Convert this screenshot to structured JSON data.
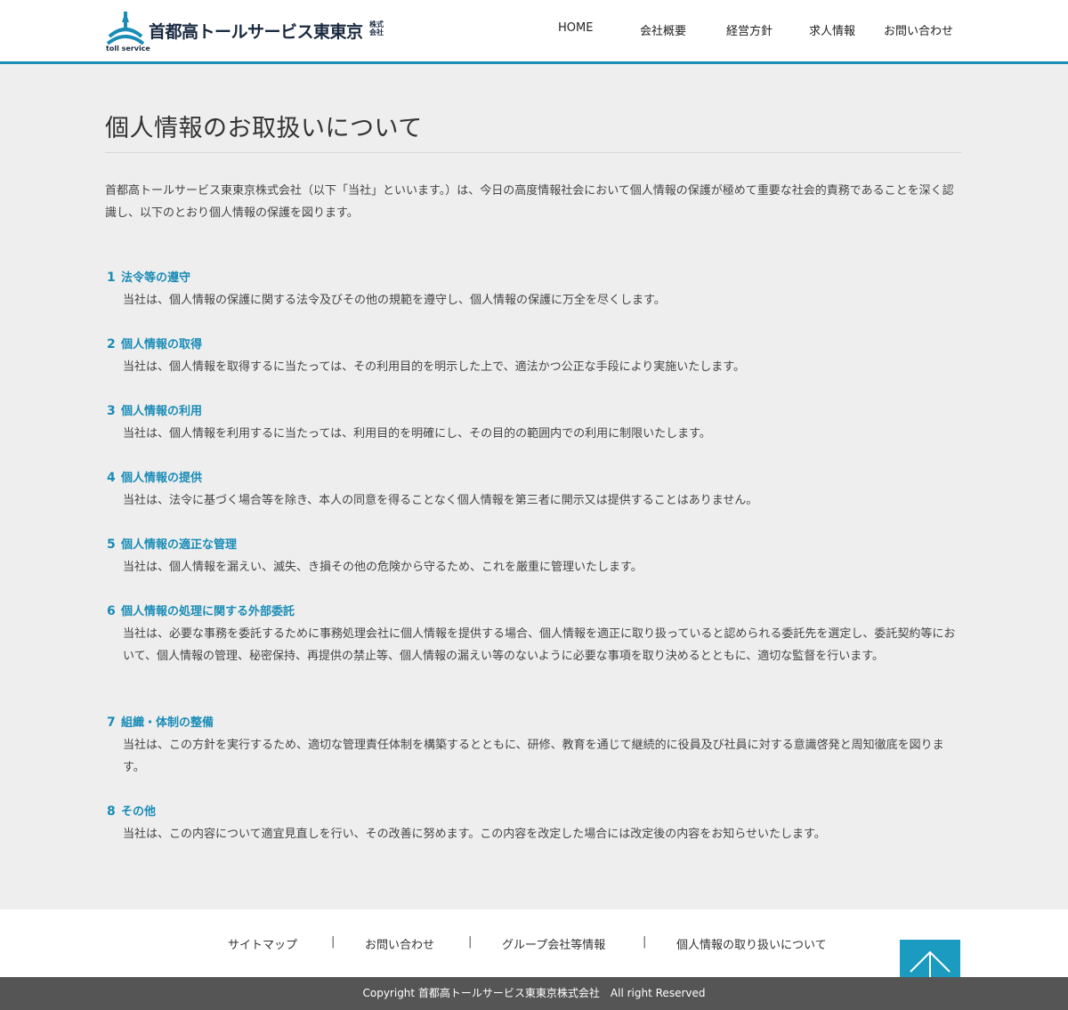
{
  "header": {
    "logo": {
      "name": "首都高トールサービス東東京",
      "kk": "株式会社",
      "sub": "toll service"
    },
    "nav": [
      {
        "label": "HOME"
      },
      {
        "label": "会社概要"
      },
      {
        "label": "経営方針"
      },
      {
        "label": "求人情報"
      },
      {
        "label": "お問い合わせ"
      }
    ]
  },
  "page": {
    "title": "個人情報のお取扱いについて",
    "intro": "首都高トールサービス東東京株式会社（以下「当社」といいます。）は、今日の高度情報社会において個人情報の保護が極めて重要な社会的責務であることを深く認識し、以下のとおり個人情報の保護を図ります。",
    "sections": [
      {
        "num": "1",
        "heading": "法令等の遵守",
        "body": "当社は、個人情報の保護に関する法令及びその他の規範を遵守し、個人情報の保護に万全を尽くします。"
      },
      {
        "num": "2",
        "heading": "個人情報の取得",
        "body": "当社は、個人情報を取得するに当たっては、その利用目的を明示した上で、適法かつ公正な手段により実施いたします。"
      },
      {
        "num": "3",
        "heading": "個人情報の利用",
        "body": "当社は、個人情報を利用するに当たっては、利用目的を明確にし、その目的の範囲内での利用に制限いたします。"
      },
      {
        "num": "4",
        "heading": "個人情報の提供",
        "body": "当社は、法令に基づく場合等を除き、本人の同意を得ることなく個人情報を第三者に開示又は提供することはありません。"
      },
      {
        "num": "5",
        "heading": "個人情報の適正な管理",
        "body": "当社は、個人情報を漏えい、滅失、き損その他の危険から守るため、これを厳重に管理いたします。"
      },
      {
        "num": "6",
        "heading": "個人情報の処理に関する外部委託",
        "body": "当社は、必要な事務を委託するために事務処理会社に個人情報を提供する場合、個人情報を適正に取り扱っていると認められる委託先を選定し、委託契約等において、個人情報の管理、秘密保持、再提供の禁止等、個人情報の漏えい等のないように必要な事項を取り決めるとともに、適切な監督を行います。"
      },
      {
        "num": "7",
        "heading": "組織・体制の整備",
        "body": "当社は、この方針を実行するため、適切な管理責任体制を構築するとともに、研修、教育を通じて継続的に役員及び社員に対する意識啓発と周知徹底を図ります。"
      },
      {
        "num": "8",
        "heading": "その他",
        "body": "当社は、この内容について適宜見直しを行い、その改善に努めます。この内容を改定した場合には改定後の内容をお知らせいたします。"
      }
    ]
  },
  "footer": {
    "links": [
      {
        "label": "サイトマップ"
      },
      {
        "label": "お問い合わせ"
      },
      {
        "label": "グループ会社等情報"
      },
      {
        "label": "個人情報の取り扱いについて"
      }
    ],
    "separator": "|",
    "copyright": "Copyright 首都高トールサービス東東京株式会社　All right Reserved"
  },
  "colors": {
    "accent": "#1a8cb6",
    "pagetop_bg": "#1a9bbf",
    "footer_bg": "#555555",
    "page_bg": "#eeeeee"
  },
  "icons": {
    "logo_mark": "triangle-wave-logo-icon",
    "pagetop": "arrow-up-icon"
  }
}
